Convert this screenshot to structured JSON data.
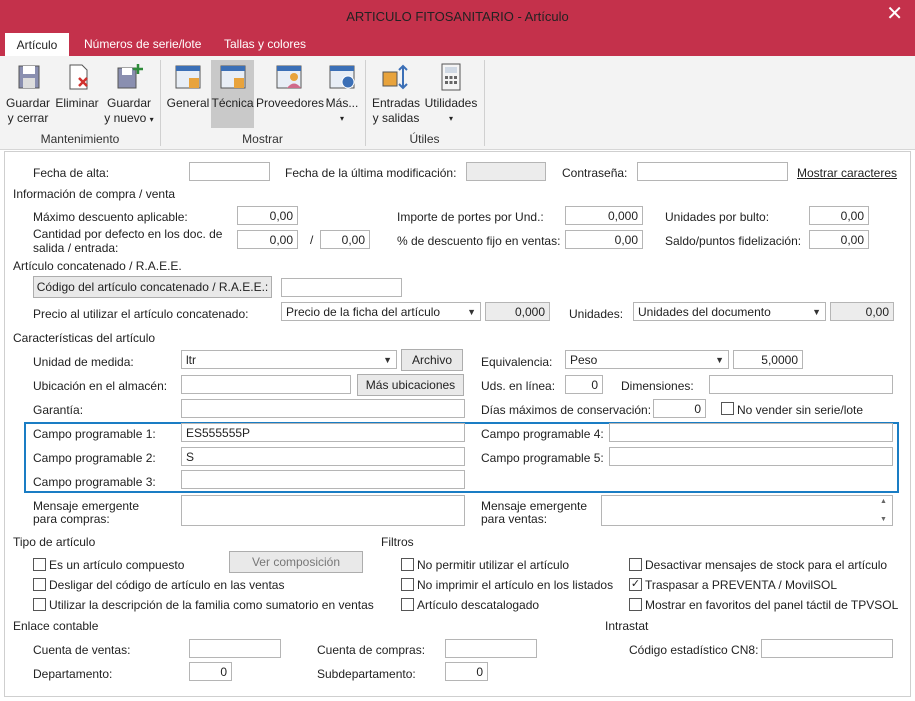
{
  "window": {
    "title": "ARTICULO FITOSANITARIO - Artículo",
    "close": "✕"
  },
  "tabs": [
    {
      "label": "Artículo"
    },
    {
      "label": "Números de serie/lote"
    },
    {
      "label": "Tallas y colores"
    }
  ],
  "ribbon": {
    "guardar_cerrar": [
      "Guardar",
      "y cerrar"
    ],
    "eliminar": "Eliminar",
    "guardar_nuevo": [
      "Guardar",
      "y nuevo"
    ],
    "general": "General",
    "tecnica": "Técnica",
    "proveedores": "Proveedores",
    "mas": "Más...",
    "entradas": [
      "Entradas",
      "y salidas"
    ],
    "utilidades": "Utilidades",
    "groups": {
      "mantenimiento": "Mantenimiento",
      "mostrar": "Mostrar",
      "utiles": "Útiles"
    }
  },
  "top": {
    "fecha_alta": {
      "label": "Fecha de alta:",
      "value": ""
    },
    "fecha_mod": {
      "label": "Fecha de la última modificación:",
      "value": ""
    },
    "contrasena": {
      "label": "Contraseña:",
      "value": ""
    },
    "mostrar_caracteres": "Mostrar caracteres"
  },
  "compra": {
    "title": "Información de compra / venta",
    "max_desc": {
      "label": "Máximo descuento aplicable:",
      "value": "0,00"
    },
    "cantidad": {
      "label1": "Cantidad por defecto en los doc. de",
      "label2": "salida / entrada:",
      "v1": "0,00",
      "slash": "/",
      "v2": "0,00"
    },
    "portes": {
      "label": "Importe de portes por Und.:",
      "value": "0,000"
    },
    "desc_fijo": {
      "label": "% de descuento fijo en ventas:",
      "value": "0,00"
    },
    "bulto": {
      "label": "Unidades por bulto:",
      "value": "0,00"
    },
    "saldo": {
      "label": "Saldo/puntos fidelización:",
      "value": "0,00"
    }
  },
  "concat": {
    "title": "Artículo concatenado / R.A.E.E.",
    "codigo_btn": "Código del artículo concatenado / R.A.E.E.:",
    "codigo_value": "",
    "precio_label": "Precio al utilizar el artículo concatenado:",
    "precio_select": "Precio de la ficha del artículo",
    "precio_value": "0,000",
    "unidades_label": "Unidades:",
    "unidades_select": "Unidades del documento",
    "unidades_value": "0,00"
  },
  "caract": {
    "title": "Características del artículo",
    "unidad": {
      "label": "Unidad de medida:",
      "value": "ltr"
    },
    "archivo": "Archivo",
    "equivalencia": {
      "label": "Equivalencia:",
      "select": "Peso",
      "value": "5,0000"
    },
    "ubicacion": {
      "label": "Ubicación en el almacén:",
      "value": ""
    },
    "mas_ubic": "Más ubicaciones",
    "uds_linea": {
      "label": "Uds. en línea:",
      "value": "0"
    },
    "dimensiones": {
      "label": "Dimensiones:",
      "value": ""
    },
    "garantia": {
      "label": "Garantía:",
      "value": ""
    },
    "dias": {
      "label": "Días máximos de conservación:",
      "value": "0"
    },
    "no_vender": {
      "label": "No vender sin serie/lote",
      "checked": false
    }
  },
  "campos": {
    "c1": {
      "label": "Campo programable 1:",
      "value": "ES555555P"
    },
    "c2": {
      "label": "Campo programable 2:",
      "value": "S"
    },
    "c3": {
      "label": "Campo programable 3:",
      "value": ""
    },
    "c4": {
      "label": "Campo programable 4:",
      "value": ""
    },
    "c5": {
      "label": "Campo programable 5:",
      "value": ""
    }
  },
  "mensajes": {
    "compras": [
      "Mensaje emergente",
      "para compras:"
    ],
    "ventas": [
      "Mensaje emergente",
      "para ventas:"
    ]
  },
  "tipo": {
    "title": "Tipo de artículo",
    "compuesto": "Es un artículo compuesto",
    "ver_comp": "Ver composición",
    "desligar": "Desligar del código de artículo en las ventas",
    "utilizar": "Utilizar la descripción de la familia como sumatorio en ventas"
  },
  "filtros": {
    "title": "Filtros",
    "no_permitir": "No permitir utilizar el artículo",
    "no_imprimir": "No imprimir el artículo en los listados",
    "descatalogado": "Artículo descatalogado",
    "desactivar": "Desactivar mensajes de stock para el artículo",
    "traspasar": "Traspasar a PREVENTA / MovilSOL",
    "mostrar_fav": "Mostrar en favoritos del panel táctil de TPVSOL",
    "traspasar_checked": true
  },
  "enlace": {
    "title": "Enlace contable",
    "cta_ventas": {
      "label": "Cuenta de ventas:",
      "value": ""
    },
    "cta_compras": {
      "label": "Cuenta de compras:",
      "value": ""
    },
    "departamento": {
      "label": "Departamento:",
      "value": "0"
    },
    "subdepartamento": {
      "label": "Subdepartamento:",
      "value": "0"
    }
  },
  "intrastat": {
    "title": "Intrastat",
    "cn8": {
      "label": "Código estadístico CN8:",
      "value": ""
    }
  },
  "colors": {
    "accent": "#c4314b",
    "highlight": "#1a7dc4"
  }
}
